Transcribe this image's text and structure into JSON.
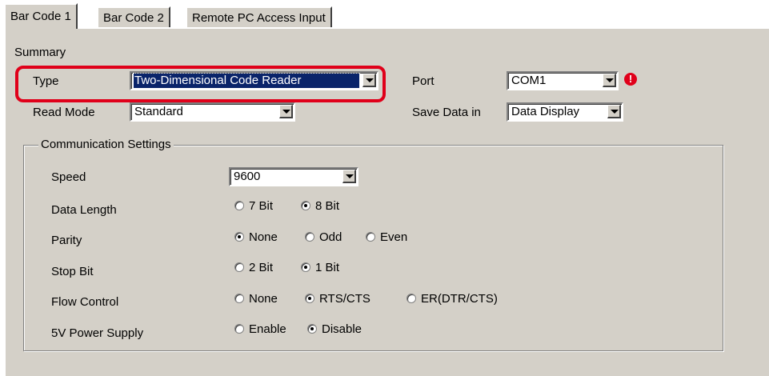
{
  "tabs": [
    "Bar Code 1",
    "Bar Code 2",
    "Remote PC Access Input"
  ],
  "summary": {
    "title": "Summary",
    "type_label": "Type",
    "type_value": "Two-Dimensional Code Reader",
    "read_mode_label": "Read Mode",
    "read_mode_value": "Standard",
    "port_label": "Port",
    "port_value": "COM1",
    "save_label": "Save Data in",
    "save_value": "Data Display",
    "warn_icon": "!"
  },
  "comm": {
    "title": "Communication Settings",
    "speed_label": "Speed",
    "speed_value": "9600",
    "data_length_label": "Data Length",
    "data_length_options": [
      "7 Bit",
      "8 Bit"
    ],
    "parity_label": "Parity",
    "parity_options": [
      "None",
      "Odd",
      "Even"
    ],
    "stop_bit_label": "Stop Bit",
    "stop_bit_options": [
      "2 Bit",
      "1 Bit"
    ],
    "flow_label": "Flow Control",
    "flow_options": [
      "None",
      "RTS/CTS",
      "ER(DTR/CTS)"
    ],
    "power_label": "5V Power Supply",
    "power_options": [
      "Enable",
      "Disable"
    ]
  },
  "colors": {
    "highlight": "#e0001a",
    "panel": "#d4d0c8",
    "selection": "#0a246a"
  }
}
